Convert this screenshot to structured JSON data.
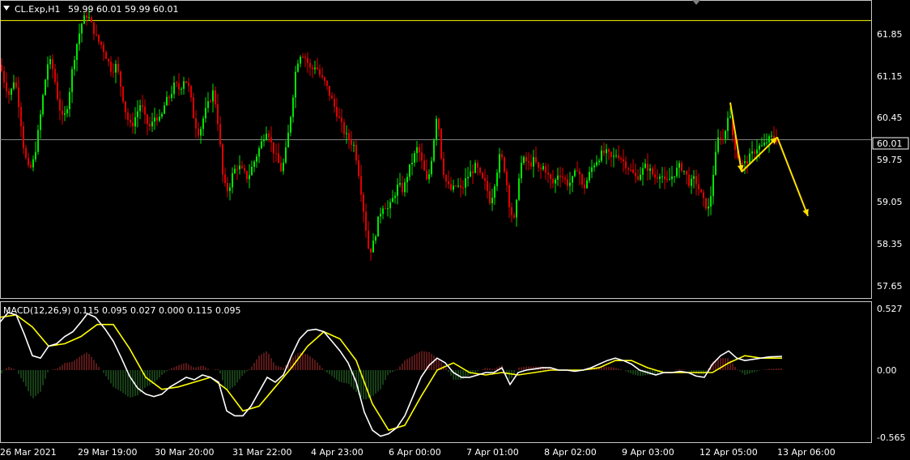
{
  "header": {
    "symbol": "CL.Exp,H1",
    "ohlc": "59.99 60.01 59.99 60.01",
    "menu_icon": "triangle-down-icon"
  },
  "colors": {
    "background": "#000000",
    "frame": "#c8c8c8",
    "bull": "#00e600",
    "bear": "#e00000",
    "level": "#ffff00",
    "price_line": "#808080",
    "macd": "#ffffff",
    "signal": "#ffff00",
    "hist_pos": "#b03030",
    "hist_neg": "#2e7d2e",
    "arrow": "#ffe000"
  },
  "price_axis": {
    "ticks": [
      "61.85",
      "61.15",
      "60.45",
      "59.75",
      "59.05",
      "58.35",
      "57.65"
    ],
    "current_label": "60.01"
  },
  "macd_panel": {
    "label": "MACD(12,26,9) 0.115 0.095 0.027 0.000 0.115 0.095",
    "ticks": [
      "0.527",
      "0.00",
      "-0.565"
    ]
  },
  "time_axis": {
    "labels": [
      "26 Mar 2021",
      "29 Mar 19:00",
      "30 Mar 20:00",
      "31 Mar 22:00",
      "4 Apr 23:00",
      "6 Apr 00:00",
      "7 Apr 01:00",
      "8 Apr 02:00",
      "9 Apr 03:00",
      "12 Apr 05:00",
      "13 Apr 06:00"
    ]
  },
  "chart_data": {
    "type": "candlestick",
    "symbol": "CL.Exp",
    "timeframe": "H1",
    "ylim": [
      57.5,
      62.2
    ],
    "current_price": 60.01,
    "horizontal_level": 61.9,
    "price_path": [
      [
        0,
        61.2
      ],
      [
        6,
        60.9
      ],
      [
        12,
        60.7
      ],
      [
        18,
        61.0
      ],
      [
        24,
        60.5
      ],
      [
        30,
        59.8
      ],
      [
        36,
        59.5
      ],
      [
        42,
        59.7
      ],
      [
        48,
        60.2
      ],
      [
        54,
        60.8
      ],
      [
        60,
        61.3
      ],
      [
        66,
        61.1
      ],
      [
        72,
        60.6
      ],
      [
        78,
        60.3
      ],
      [
        84,
        60.6
      ],
      [
        90,
        61.2
      ],
      [
        96,
        61.6
      ],
      [
        102,
        61.9
      ],
      [
        108,
        62.0
      ],
      [
        114,
        61.8
      ],
      [
        120,
        61.6
      ],
      [
        126,
        61.5
      ],
      [
        132,
        61.3
      ],
      [
        138,
        61.1
      ],
      [
        144,
        61.2
      ],
      [
        150,
        60.8
      ],
      [
        156,
        60.4
      ],
      [
        162,
        60.2
      ],
      [
        168,
        60.4
      ],
      [
        174,
        60.6
      ],
      [
        180,
        60.3
      ],
      [
        186,
        60.2
      ],
      [
        192,
        60.4
      ],
      [
        198,
        60.3
      ],
      [
        204,
        60.6
      ],
      [
        210,
        60.7
      ],
      [
        216,
        60.9
      ],
      [
        222,
        60.8
      ],
      [
        228,
        61.0
      ],
      [
        234,
        60.8
      ],
      [
        240,
        60.3
      ],
      [
        246,
        60.1
      ],
      [
        252,
        60.4
      ],
      [
        258,
        60.6
      ],
      [
        264,
        60.8
      ],
      [
        270,
        60.2
      ],
      [
        276,
        59.3
      ],
      [
        282,
        59.2
      ],
      [
        288,
        59.5
      ],
      [
        294,
        59.6
      ],
      [
        300,
        59.5
      ],
      [
        306,
        59.4
      ],
      [
        312,
        59.6
      ],
      [
        318,
        59.8
      ],
      [
        324,
        60.0
      ],
      [
        330,
        60.2
      ],
      [
        336,
        59.9
      ],
      [
        342,
        59.7
      ],
      [
        348,
        59.5
      ],
      [
        354,
        59.9
      ],
      [
        360,
        60.5
      ],
      [
        366,
        61.2
      ],
      [
        372,
        61.4
      ],
      [
        378,
        61.3
      ],
      [
        384,
        61.1
      ],
      [
        390,
        61.2
      ],
      [
        396,
        61.0
      ],
      [
        402,
        60.9
      ],
      [
        408,
        60.7
      ],
      [
        414,
        60.5
      ],
      [
        420,
        60.3
      ],
      [
        426,
        60.1
      ],
      [
        432,
        60.0
      ],
      [
        438,
        59.9
      ],
      [
        444,
        59.4
      ],
      [
        450,
        58.8
      ],
      [
        456,
        58.2
      ],
      [
        462,
        58.4
      ],
      [
        468,
        58.8
      ],
      [
        474,
        59.0
      ],
      [
        480,
        58.9
      ],
      [
        486,
        59.1
      ],
      [
        492,
        59.3
      ],
      [
        498,
        59.2
      ],
      [
        504,
        59.5
      ],
      [
        510,
        59.7
      ],
      [
        516,
        59.9
      ],
      [
        522,
        59.6
      ],
      [
        528,
        59.3
      ],
      [
        534,
        59.8
      ],
      [
        540,
        60.5
      ],
      [
        546,
        59.6
      ],
      [
        552,
        59.3
      ],
      [
        558,
        59.2
      ],
      [
        564,
        59.3
      ],
      [
        570,
        59.2
      ],
      [
        576,
        59.4
      ],
      [
        582,
        59.5
      ],
      [
        588,
        59.6
      ],
      [
        594,
        59.4
      ],
      [
        600,
        59.3
      ],
      [
        606,
        59.0
      ],
      [
        612,
        59.4
      ],
      [
        618,
        59.8
      ],
      [
        624,
        59.5
      ],
      [
        630,
        58.9
      ],
      [
        636,
        58.7
      ],
      [
        642,
        59.6
      ],
      [
        648,
        59.7
      ],
      [
        654,
        59.6
      ],
      [
        660,
        59.7
      ],
      [
        666,
        59.5
      ],
      [
        672,
        59.6
      ],
      [
        678,
        59.4
      ],
      [
        684,
        59.3
      ],
      [
        690,
        59.5
      ],
      [
        696,
        59.4
      ],
      [
        702,
        59.3
      ],
      [
        708,
        59.4
      ],
      [
        714,
        59.6
      ],
      [
        720,
        59.2
      ],
      [
        726,
        59.4
      ],
      [
        732,
        59.6
      ],
      [
        738,
        59.7
      ],
      [
        744,
        59.8
      ],
      [
        750,
        59.8
      ],
      [
        756,
        59.7
      ],
      [
        762,
        59.8
      ],
      [
        768,
        59.7
      ],
      [
        774,
        59.6
      ],
      [
        780,
        59.5
      ],
      [
        786,
        59.4
      ],
      [
        792,
        59.5
      ],
      [
        798,
        59.6
      ],
      [
        804,
        59.5
      ],
      [
        810,
        59.4
      ],
      [
        816,
        59.5
      ],
      [
        822,
        59.3
      ],
      [
        828,
        59.4
      ],
      [
        834,
        59.5
      ],
      [
        840,
        59.6
      ],
      [
        846,
        59.5
      ],
      [
        852,
        59.3
      ],
      [
        858,
        59.4
      ],
      [
        864,
        59.2
      ],
      [
        870,
        59.0
      ],
      [
        876,
        58.9
      ],
      [
        882,
        59.6
      ],
      [
        888,
        60.1
      ],
      [
        894,
        60.0
      ],
      [
        900,
        60.5
      ],
      [
        906,
        60.0
      ],
      [
        912,
        59.7
      ],
      [
        918,
        59.6
      ],
      [
        924,
        59.7
      ],
      [
        930,
        59.8
      ],
      [
        936,
        59.9
      ],
      [
        942,
        59.9
      ],
      [
        948,
        60.0
      ],
      [
        954,
        60.05
      ],
      [
        960,
        60.01
      ]
    ],
    "arrow_path": [
      [
        902,
        60.6
      ],
      [
        916,
        59.5
      ],
      [
        960,
        60.05
      ],
      [
        998,
        58.8
      ]
    ],
    "macd_ylim": [
      -0.6,
      0.56
    ],
    "macd_line": [
      [
        0,
        0.4
      ],
      [
        10,
        0.48
      ],
      [
        20,
        0.46
      ],
      [
        30,
        0.3
      ],
      [
        40,
        0.12
      ],
      [
        50,
        0.1
      ],
      [
        60,
        0.2
      ],
      [
        70,
        0.22
      ],
      [
        80,
        0.28
      ],
      [
        90,
        0.32
      ],
      [
        100,
        0.4
      ],
      [
        108,
        0.47
      ],
      [
        118,
        0.44
      ],
      [
        130,
        0.34
      ],
      [
        140,
        0.24
      ],
      [
        150,
        0.1
      ],
      [
        160,
        -0.05
      ],
      [
        170,
        -0.15
      ],
      [
        180,
        -0.2
      ],
      [
        190,
        -0.22
      ],
      [
        200,
        -0.2
      ],
      [
        210,
        -0.14
      ],
      [
        220,
        -0.1
      ],
      [
        230,
        -0.06
      ],
      [
        240,
        -0.08
      ],
      [
        250,
        -0.04
      ],
      [
        260,
        -0.06
      ],
      [
        270,
        -0.1
      ],
      [
        280,
        -0.34
      ],
      [
        290,
        -0.38
      ],
      [
        300,
        -0.38
      ],
      [
        310,
        -0.3
      ],
      [
        320,
        -0.18
      ],
      [
        330,
        -0.06
      ],
      [
        340,
        -0.1
      ],
      [
        350,
        -0.04
      ],
      [
        360,
        0.12
      ],
      [
        370,
        0.26
      ],
      [
        380,
        0.33
      ],
      [
        390,
        0.34
      ],
      [
        400,
        0.32
      ],
      [
        410,
        0.24
      ],
      [
        420,
        0.16
      ],
      [
        430,
        0.06
      ],
      [
        440,
        -0.1
      ],
      [
        450,
        -0.35
      ],
      [
        460,
        -0.5
      ],
      [
        470,
        -0.55
      ],
      [
        480,
        -0.53
      ],
      [
        490,
        -0.48
      ],
      [
        500,
        -0.38
      ],
      [
        510,
        -0.22
      ],
      [
        520,
        -0.06
      ],
      [
        530,
        0.04
      ],
      [
        540,
        0.1
      ],
      [
        550,
        0.06
      ],
      [
        560,
        -0.02
      ],
      [
        570,
        -0.06
      ],
      [
        580,
        -0.06
      ],
      [
        590,
        -0.04
      ],
      [
        600,
        -0.02
      ],
      [
        610,
        -0.02
      ],
      [
        620,
        0.02
      ],
      [
        630,
        -0.12
      ],
      [
        640,
        -0.02
      ],
      [
        650,
        0.0
      ],
      [
        660,
        0.01
      ],
      [
        670,
        0.02
      ],
      [
        680,
        0.02
      ],
      [
        690,
        0.0
      ],
      [
        700,
        0.0
      ],
      [
        710,
        -0.01
      ],
      [
        720,
        0.0
      ],
      [
        730,
        0.02
      ],
      [
        740,
        0.05
      ],
      [
        750,
        0.08
      ],
      [
        760,
        0.1
      ],
      [
        770,
        0.08
      ],
      [
        780,
        0.05
      ],
      [
        790,
        0.0
      ],
      [
        800,
        -0.02
      ],
      [
        810,
        -0.04
      ],
      [
        820,
        -0.02
      ],
      [
        830,
        -0.02
      ],
      [
        840,
        -0.01
      ],
      [
        850,
        -0.02
      ],
      [
        860,
        -0.05
      ],
      [
        870,
        -0.06
      ],
      [
        880,
        0.05
      ],
      [
        890,
        0.12
      ],
      [
        900,
        0.16
      ],
      [
        910,
        0.1
      ],
      [
        920,
        0.08
      ],
      [
        930,
        0.09
      ],
      [
        940,
        0.1
      ],
      [
        950,
        0.11
      ],
      [
        966,
        0.115
      ]
    ],
    "signal_line": [
      [
        0,
        0.44
      ],
      [
        20,
        0.46
      ],
      [
        40,
        0.36
      ],
      [
        60,
        0.2
      ],
      [
        80,
        0.22
      ],
      [
        100,
        0.28
      ],
      [
        120,
        0.38
      ],
      [
        140,
        0.38
      ],
      [
        160,
        0.18
      ],
      [
        180,
        -0.06
      ],
      [
        200,
        -0.16
      ],
      [
        220,
        -0.14
      ],
      [
        240,
        -0.1
      ],
      [
        260,
        -0.06
      ],
      [
        280,
        -0.16
      ],
      [
        300,
        -0.34
      ],
      [
        320,
        -0.3
      ],
      [
        340,
        -0.14
      ],
      [
        360,
        0.02
      ],
      [
        380,
        0.2
      ],
      [
        400,
        0.32
      ],
      [
        420,
        0.26
      ],
      [
        440,
        0.08
      ],
      [
        460,
        -0.28
      ],
      [
        480,
        -0.5
      ],
      [
        500,
        -0.46
      ],
      [
        520,
        -0.22
      ],
      [
        540,
        0.0
      ],
      [
        560,
        0.06
      ],
      [
        580,
        -0.02
      ],
      [
        600,
        -0.04
      ],
      [
        620,
        -0.02
      ],
      [
        640,
        -0.04
      ],
      [
        660,
        -0.02
      ],
      [
        680,
        0.0
      ],
      [
        700,
        0.0
      ],
      [
        720,
        0.0
      ],
      [
        740,
        0.02
      ],
      [
        760,
        0.08
      ],
      [
        780,
        0.08
      ],
      [
        800,
        0.02
      ],
      [
        820,
        -0.02
      ],
      [
        840,
        -0.02
      ],
      [
        860,
        -0.02
      ],
      [
        880,
        -0.02
      ],
      [
        900,
        0.06
      ],
      [
        920,
        0.12
      ],
      [
        940,
        0.1
      ],
      [
        966,
        0.1
      ]
    ]
  }
}
